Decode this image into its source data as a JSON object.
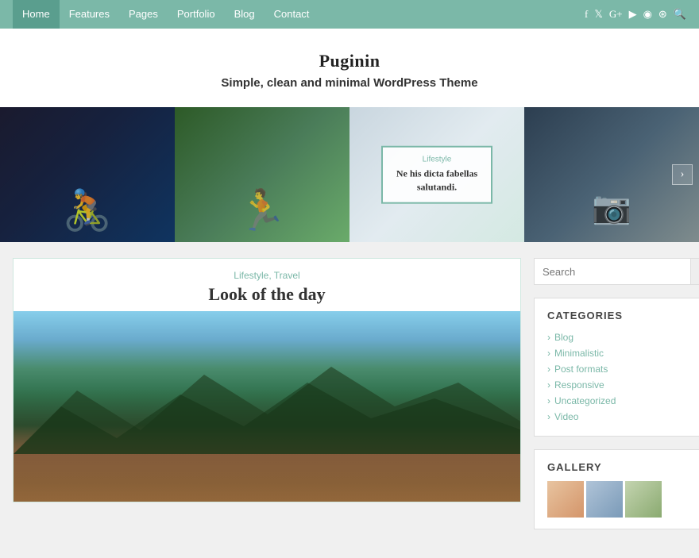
{
  "nav": {
    "links": [
      {
        "label": "Home",
        "active": true
      },
      {
        "label": "Features",
        "active": false
      },
      {
        "label": "Pages",
        "active": false
      },
      {
        "label": "Portfolio",
        "active": false
      },
      {
        "label": "Blog",
        "active": false
      },
      {
        "label": "Contact",
        "active": false
      }
    ],
    "icons": [
      "f",
      "t",
      "g+",
      "yt",
      "ig",
      "be",
      "🔍"
    ]
  },
  "header": {
    "site_title": "Puginin",
    "site_tagline": "Simple, clean and minimal WordPress Theme"
  },
  "slider": {
    "overlay_category": "Lifestyle",
    "overlay_text": "Ne his dicta fabellas salutandi.",
    "arrow_right": "›",
    "arrow_left": "‹"
  },
  "post": {
    "categories": "Lifestyle, Travel",
    "title": "Look of the day"
  },
  "sidebar": {
    "search_placeholder": "Search",
    "search_btn_label": "🔍",
    "categories_title": "CATEGORIES",
    "categories": [
      {
        "label": "Blog"
      },
      {
        "label": "Minimalistic"
      },
      {
        "label": "Post formats"
      },
      {
        "label": "Responsive"
      },
      {
        "label": "Uncategorized"
      },
      {
        "label": "Video"
      }
    ],
    "gallery_title": "GALLERY",
    "gallery_thumbs": [
      "thumb1",
      "thumb2",
      "thumb3"
    ]
  }
}
